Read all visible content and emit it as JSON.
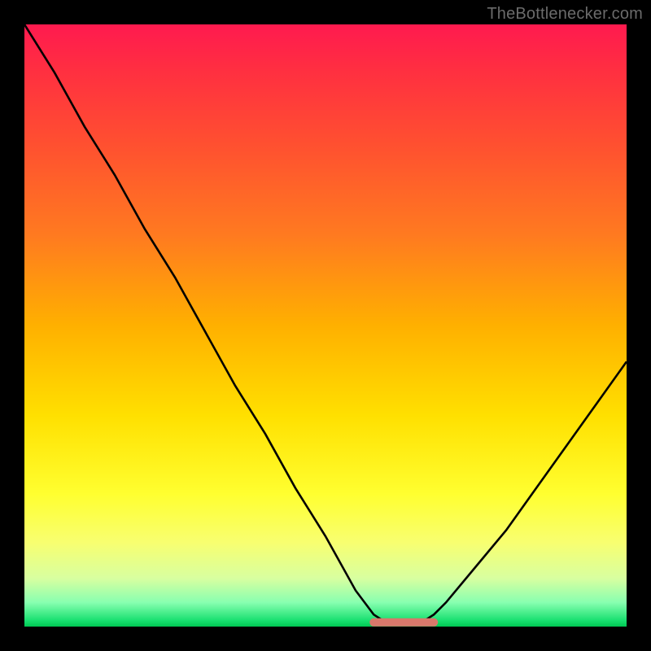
{
  "watermark": "TheBottlenecker.com",
  "chart_data": {
    "type": "line",
    "title": "",
    "xlabel": "",
    "ylabel": "",
    "xlim": [
      0,
      100
    ],
    "ylim": [
      0,
      100
    ],
    "series": [
      {
        "name": "bottleneck-curve",
        "x": [
          0,
          5,
          10,
          15,
          20,
          25,
          30,
          35,
          40,
          45,
          50,
          55,
          58,
          60,
          62,
          64,
          66,
          68,
          70,
          75,
          80,
          85,
          90,
          95,
          100
        ],
        "y": [
          100,
          92,
          83,
          75,
          66,
          58,
          49,
          40,
          32,
          23,
          15,
          6,
          2,
          0.7,
          0.3,
          0.3,
          0.7,
          2,
          4,
          10,
          16,
          23,
          30,
          37,
          44
        ]
      },
      {
        "name": "optimal-band",
        "x": [
          58,
          68
        ],
        "y": [
          0.7,
          0.7
        ]
      }
    ],
    "background_gradient_stops": [
      {
        "pos": 0,
        "color": "#ff1a4f"
      },
      {
        "pos": 50,
        "color": "#ffe000"
      },
      {
        "pos": 95,
        "color": "#88ffb0"
      },
      {
        "pos": 100,
        "color": "#00c853"
      }
    ],
    "optimal_band_color": "#d9786b"
  }
}
